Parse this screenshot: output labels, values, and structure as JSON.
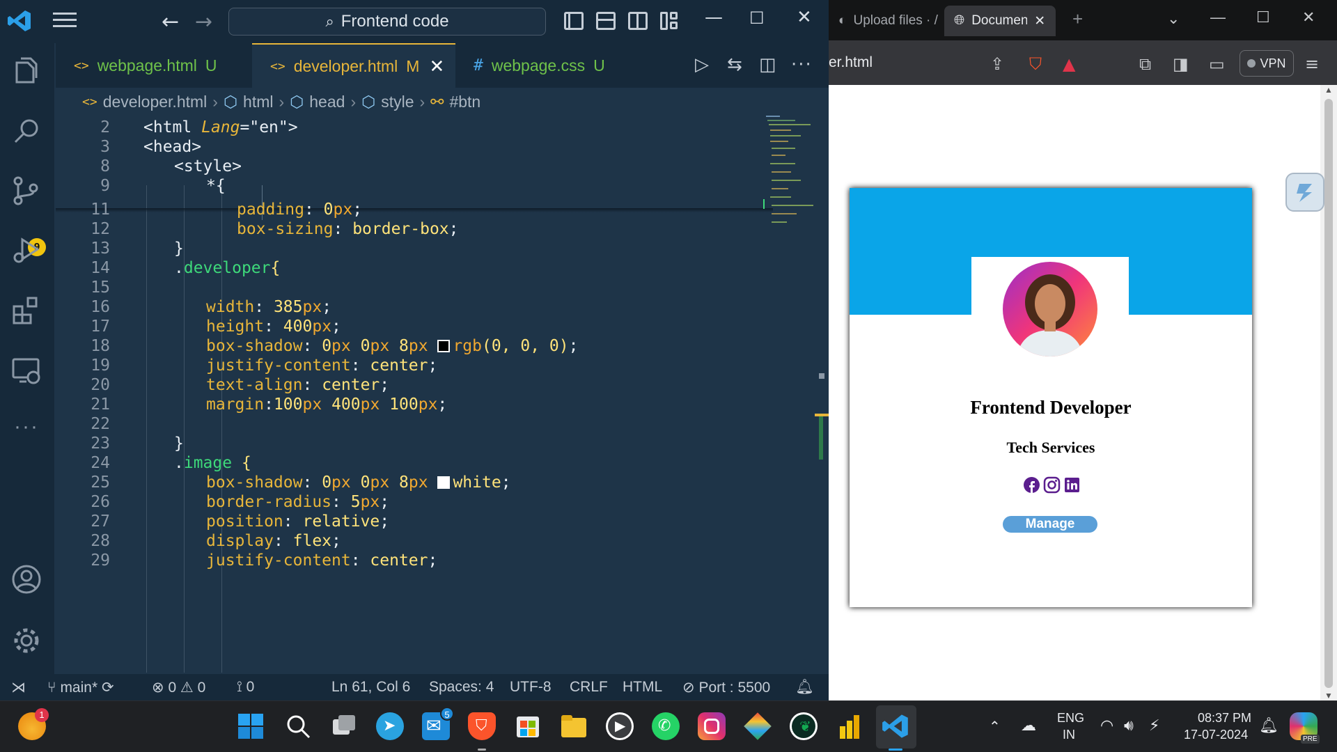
{
  "vscode": {
    "command_center": "Frontend code",
    "tabs": [
      {
        "label": "webpage.html",
        "status": "U",
        "icon": "<>",
        "color": "#6fc24a"
      },
      {
        "label": "developer.html",
        "status": "M",
        "icon": "<>",
        "color": "#e8b63a"
      },
      {
        "label": "webpage.css",
        "status": "U",
        "icon": "#",
        "color": "#6fc24a"
      }
    ],
    "breadcrumb": [
      "developer.html",
      "html",
      "head",
      "style",
      "#btn"
    ],
    "scm_badge": "9",
    "status": {
      "branch": "main*",
      "errors": "0",
      "warnings": "0",
      "ports": "0",
      "position": "Ln 61, Col 6",
      "spaces": "Spaces: 4",
      "encoding": "UTF-8",
      "eol": "CRLF",
      "language": "HTML",
      "port": "Port : 5500"
    },
    "code_lines": [
      {
        "n": "2"
      },
      {
        "n": "3"
      },
      {
        "n": "8"
      },
      {
        "n": "9"
      },
      {
        "n": "11"
      },
      {
        "n": "12"
      },
      {
        "n": "13"
      },
      {
        "n": "14"
      },
      {
        "n": "15"
      },
      {
        "n": "16"
      },
      {
        "n": "17"
      },
      {
        "n": "18"
      },
      {
        "n": "19"
      },
      {
        "n": "20"
      },
      {
        "n": "21"
      },
      {
        "n": "22"
      },
      {
        "n": "23"
      },
      {
        "n": "24"
      },
      {
        "n": "25"
      },
      {
        "n": "26"
      },
      {
        "n": "27"
      },
      {
        "n": "28"
      },
      {
        "n": "29"
      }
    ],
    "code": {
      "l2": {
        "open": "<html",
        "attr": "Lang",
        "eq": "=",
        "val": "\"en\"",
        "close": ">"
      },
      "l3": "<head>",
      "l8": "<style>",
      "l9": "*{",
      "l11": {
        "prop": "padding",
        "num": "0",
        "unit": "px"
      },
      "l12": {
        "prop": "box-sizing",
        "val": "border-box"
      },
      "l13": "}",
      "l14": {
        "sel": "developer",
        "brace": "{"
      },
      "l16": {
        "prop": "width",
        "num": "385",
        "unit": "px"
      },
      "l17": {
        "prop": "height",
        "num": "400",
        "unit": "px"
      },
      "l18": {
        "prop": "box-shadow",
        "n1": "0",
        "n2": "0",
        "n3": "8",
        "fn": "rgb",
        "args": "(0, 0, 0)"
      },
      "l19": {
        "prop": "justify-content",
        "val": "center"
      },
      "l20": {
        "prop": "text-align",
        "val": "center"
      },
      "l21": {
        "prop": "margin",
        "n1": "100",
        "n2": "400",
        "n3": "100"
      },
      "l23": "}",
      "l24": {
        "sel": "image",
        "brace": "{"
      },
      "l25": {
        "prop": "box-shadow",
        "n1": "0",
        "n2": "0",
        "n3": "8",
        "val": "white"
      },
      "l26": {
        "prop": "border-radius",
        "num": "5",
        "unit": "px"
      },
      "l27": {
        "prop": "position",
        "val": "relative"
      },
      "l28": {
        "prop": "display",
        "val": "flex"
      },
      "l29": {
        "prop": "justify-content",
        "val": "center"
      }
    }
  },
  "browser": {
    "tabs": [
      {
        "label": "Upload files · /"
      },
      {
        "label": "Documen"
      }
    ],
    "url": "er.html",
    "vpn": "VPN",
    "card": {
      "title": "Frontend Developer",
      "subtitle": "Tech Services",
      "button": "Manage",
      "banner_color": "#0aa5e8"
    }
  },
  "taskbar": {
    "notif_badge": "1",
    "mail_badge": "5",
    "lang_top": "ENG",
    "lang_bottom": "IN",
    "time": "08:37 PM",
    "date": "17-07-2024",
    "copilot_tag": "PRE"
  }
}
